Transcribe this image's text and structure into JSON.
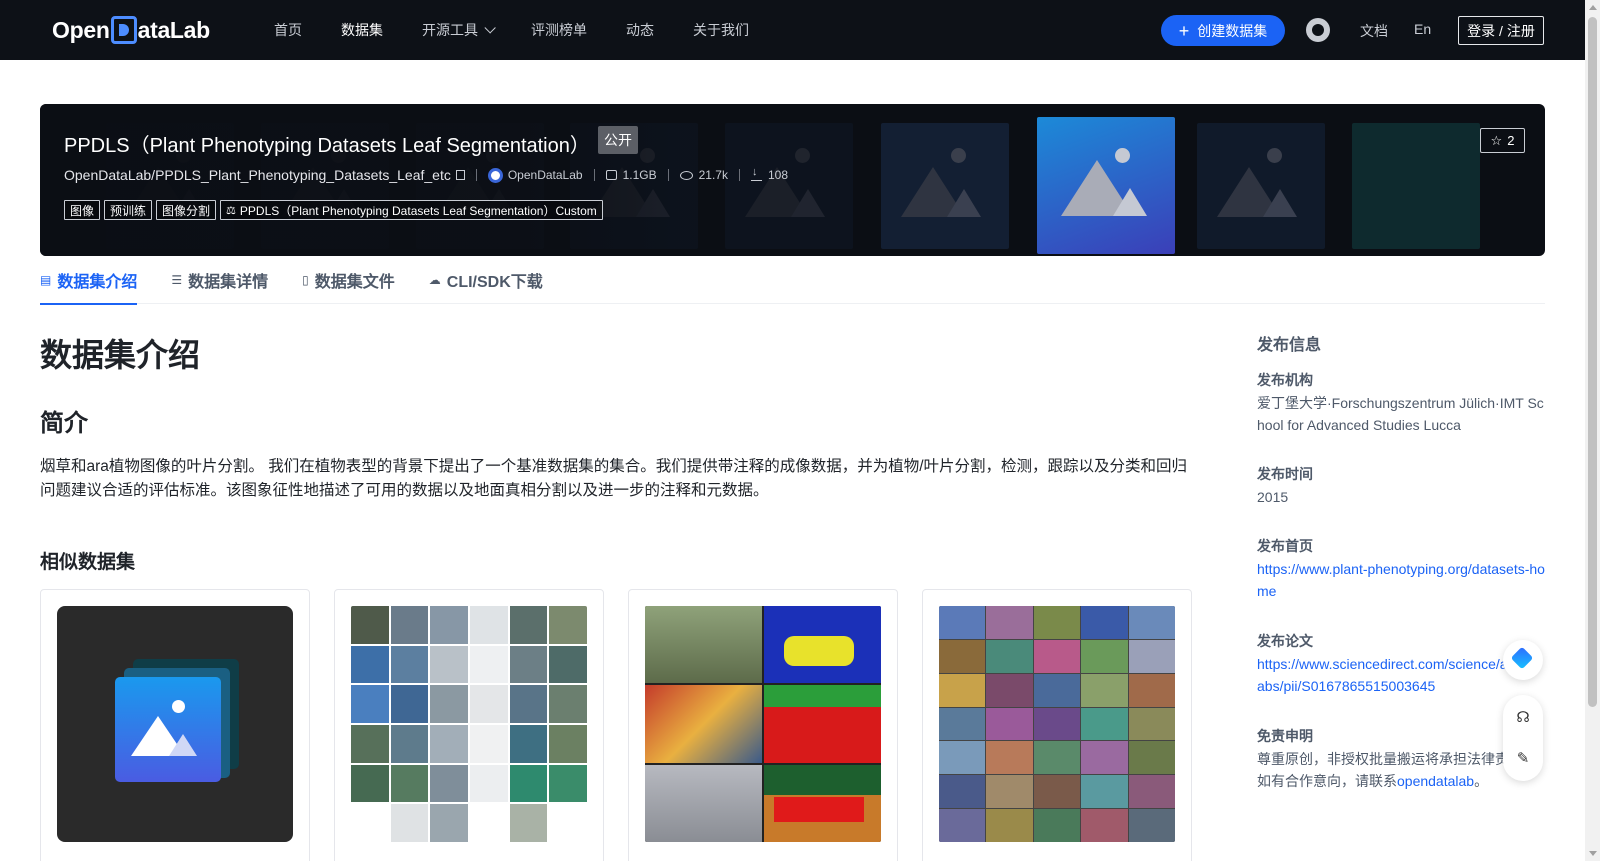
{
  "nav": {
    "logo_prefix": "Open",
    "logo_suffix": "ataLab",
    "items": [
      "首页",
      "数据集",
      "开源工具",
      "评测榜单",
      "动态",
      "关于我们"
    ],
    "create_label": "创建数据集",
    "doc_label": "文档",
    "lang_label": "En",
    "login_label": "登录 / 注册"
  },
  "hero": {
    "title": "PPDLS（Plant Phenotyping Datasets Leaf Segmentation）",
    "visibility": "公开",
    "repo_path": "OpenDataLab/PPDLS_Plant_Phenotyping_Datasets_Leaf_etc",
    "org": "OpenDataLab",
    "size": "1.1GB",
    "views": "21.7k",
    "downloads": "108",
    "tags": [
      "图像",
      "预训练",
      "图像分割"
    ],
    "license": "PPDLS（Plant Phenotyping Datasets Leaf Segmentation）Custom",
    "stars": "2"
  },
  "tabs": [
    "数据集介绍",
    "数据集详情",
    "数据集文件",
    "CLI/SDK下载"
  ],
  "main": {
    "title": "数据集介绍",
    "section_title": "简介",
    "intro": "烟草和ara植物图像的叶片分割。 我们在植物表型的背景下提出了一个基准数据集的集合。我们提供带注释的成像数据，并为植物/叶片分割，检测，跟踪以及分类和回归问题建议合适的评估标准。该图象征性地描述了可用的数据以及地面真相分割以及进一步的注释和元数据。",
    "similar_title": "相似数据集"
  },
  "side": {
    "title": "发布信息",
    "org_label": "发布机构",
    "org_value": "爱丁堡大学·Forschungszentrum Jülich·IMT School for Advanced Studies Lucca",
    "time_label": "发布时间",
    "time_value": "2015",
    "home_label": "发布首页",
    "home_value": "https://www.plant-phenotyping.org/datasets-home",
    "paper_label": "发布论文",
    "paper_value": "https://www.sciencedirect.com/science/article/abs/pii/S0167865515003645",
    "disclaimer_label": "免责申明",
    "disclaimer_text": "尊重原创，非授权批量搬运将承担法律责任，如有合作意向，请联系",
    "disclaimer_link": "opendatalab",
    "disclaimer_end": "。"
  },
  "colors": {
    "accent": "#1b63f5",
    "nav_bg": "#0d1117",
    "hero_bg": "#0b0e14"
  }
}
